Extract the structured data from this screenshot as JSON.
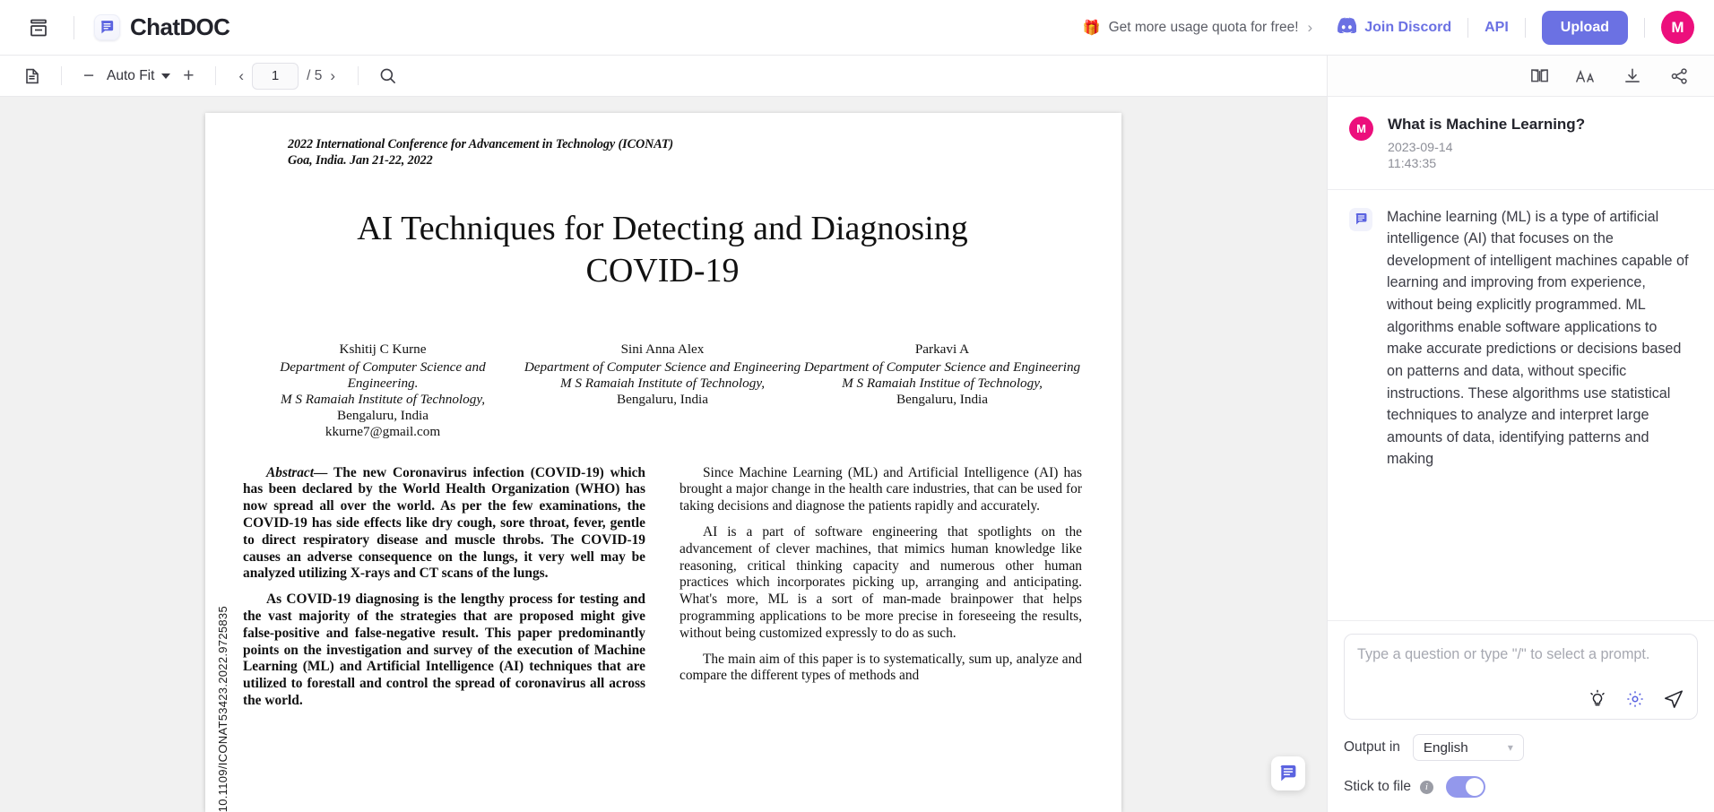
{
  "header": {
    "hamburger_icon": "archive-box-icon",
    "brand_name": "ChatDOC",
    "brand_logo_icon": "chat-document-icon",
    "quota_text": "Get more usage quota for free!",
    "quota_gift_icon": "gift-icon",
    "quota_chevron": "›",
    "discord_label": "Join Discord",
    "discord_icon": "discord-icon",
    "api_label": "API",
    "upload_label": "Upload",
    "avatar_initial": "M",
    "accent_color": "#6b71e3",
    "avatar_color": "#ec0f7c"
  },
  "pdf_toolbar": {
    "thumbnail_icon": "document-outline-icon",
    "zoom_out": "−",
    "zoom_level": "Auto Fit",
    "zoom_in": "+",
    "prev_page_icon": "chevron-left-icon",
    "page_number": "1",
    "page_total": "/ 5",
    "next_page_icon": "chevron-right-icon",
    "search_icon": "search-icon"
  },
  "chat_toolbar": {
    "icons": [
      "book-icon",
      "font-size-icon",
      "download-icon",
      "share-icon"
    ]
  },
  "document": {
    "conference_line1": "2022 International Conference for Advancement in Technology (ICONAT)",
    "conference_line2": "Goa, India. Jan 21-22, 2022",
    "title": "AI Techniques for Detecting and Diagnosing COVID-19",
    "doi": "10.1109/ICONAT53423.2022.9725835",
    "authors": [
      {
        "name": "Kshitij C Kurne",
        "dept": "Department of Computer Science and Engineering.",
        "institute": "M S Ramaiah Institute of Technology,",
        "city": "Bengaluru, India",
        "email": "kkurne7@gmail.com"
      },
      {
        "name": "Sini Anna Alex",
        "dept": "Department of Computer Science and Engineering",
        "institute": "M S Ramaiah Institute of Technology,",
        "city": "Bengaluru, India",
        "email": ""
      },
      {
        "name": "Parkavi A",
        "dept": "Department of Computer Science and Engineering",
        "institute": "M S Ramaiah Institue of Technology,",
        "city": "Bengaluru, India",
        "email": ""
      }
    ],
    "abstract_lead": "Abstract—",
    "abstract_body": " The new Coronavirus infection (COVID-19) which has been declared by the World Health Organization (WHO) has now spread all over the world. As per the few examinations, the COVID-19 has side effects like dry cough, sore throat, fever, gentle to direct respiratory disease and muscle throbs. The COVID-19 causes an adverse consequence on the lungs, it very well may be analyzed utilizing X-rays and CT scans of the lungs.",
    "left_para2": "As COVID-19 diagnosing is the lengthy process for testing and the vast majority of the strategies that are proposed might give false-positive and false-negative result. This paper predominantly points on the investigation and survey of the execution of Machine Learning (ML) and Artificial Intelligence (AI) techniques that are utilized to forestall and control the spread of coronavirus all across the world.",
    "right_para1": "Since Machine Learning (ML) and Artificial Intelligence (AI) has brought a major change in the health care industries, that can be used for taking decisions and diagnose the patients rapidly and accurately.",
    "right_para2": "AI is a part of software engineering that spotlights on the advancement of clever machines, that mimics human knowledge like reasoning, critical thinking capacity and numerous other human practices which incorporates picking up, arranging and anticipating. What's more, ML is a sort of man-made brainpower that helps programming applications to be more precise in foreseeing the results, without being customized expressly to do as such.",
    "right_para3": "The main aim of this paper is to systematically, sum up, analyze and compare the different types of methods and",
    "float_chat_icon": "chat-bubble-icon"
  },
  "chat": {
    "question_avatar": "M",
    "question": "What is Machine Learning?",
    "timestamp": "2023-09-14 11:43:35",
    "answer_icon": "chat-document-icon",
    "answer": "Machine learning (ML) is a type of artificial intelligence (AI) that focuses on the development of intelligent machines capable of learning and improving from experience, without being explicitly programmed. ML algorithms enable software applications to make accurate predictions or decisions based on patterns and data, without specific instructions. These algorithms use statistical techniques to analyze and interpret large amounts of data, identifying patterns and making"
  },
  "composer": {
    "placeholder": "Type a question or type \"/\" to select a prompt.",
    "value": "",
    "prompt_icon": "lightbulb-icon",
    "settings_icon": "gear-icon",
    "send_icon": "send-icon",
    "output_label": "Output in",
    "output_language": "English",
    "stick_label": "Stick to file",
    "info_icon": "info-icon",
    "stick_enabled": "on"
  }
}
